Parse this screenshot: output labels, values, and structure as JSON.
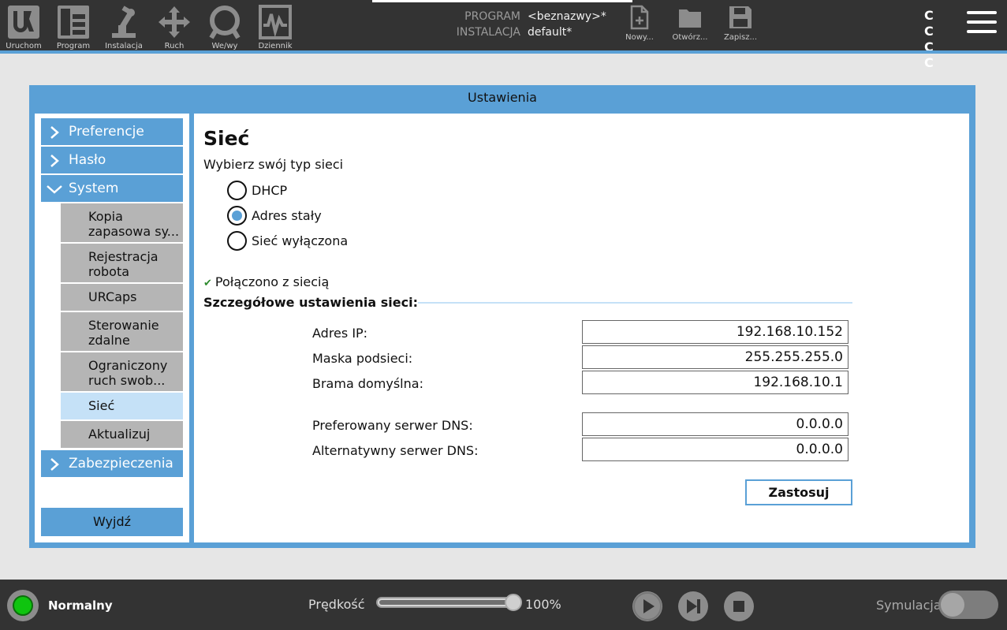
{
  "topbar": {
    "nav": [
      {
        "label": "Uruchom",
        "icon": "ur-logo-icon"
      },
      {
        "label": "Program",
        "icon": "program-tree-icon"
      },
      {
        "label": "Instalacja",
        "icon": "robot-arm-icon"
      },
      {
        "label": "Ruch",
        "icon": "move-arrows-icon"
      },
      {
        "label": "We/wy",
        "icon": "io-icon"
      },
      {
        "label": "Dziennik",
        "icon": "log-waveform-icon"
      }
    ],
    "program_key": "PROGRAM",
    "program_value": "<beznazwy>*",
    "installation_key": "INSTALACJA",
    "installation_value": "default*",
    "file_actions": [
      {
        "label": "Nowy...",
        "icon": "new-file-icon"
      },
      {
        "label": "Otwórz...",
        "icon": "folder-icon"
      },
      {
        "label": "Zapisz...",
        "icon": "save-disk-icon"
      }
    ],
    "cc_glyphs": "C C C C",
    "accent_color": "#5aa0d6"
  },
  "dialog": {
    "title": "Ustawienia",
    "sidebar": {
      "top_items": [
        {
          "label": "Preferencje",
          "expanded": false
        },
        {
          "label": "Hasło",
          "expanded": false
        },
        {
          "label": "System",
          "expanded": true
        },
        {
          "label": "Zabezpieczenia",
          "expanded": false
        }
      ],
      "system_items": [
        {
          "label": "Kopia\nzapasowa sy..."
        },
        {
          "label": "Rejestracja\nrobota"
        },
        {
          "label": "URCaps"
        },
        {
          "label": "Sterowanie\nzdalne"
        },
        {
          "label": "Ograniczony\nruch swob..."
        },
        {
          "label": "Sieć",
          "active": true
        },
        {
          "label": "Aktualizuj"
        }
      ],
      "exit_label": "Wyjdź"
    },
    "network": {
      "title": "Sieć",
      "choose_label": "Wybierz swój typ sieci",
      "options": [
        {
          "label": "DHCP",
          "selected": false
        },
        {
          "label": "Adres stały",
          "selected": true
        },
        {
          "label": "Sieć wyłączona",
          "selected": false
        }
      ],
      "status_text": "Połączono z siecią",
      "details_header": "Szczegółowe ustawienia sieci:",
      "fields": [
        {
          "label": "Adres IP:",
          "value": "192.168.10.152"
        },
        {
          "label": "Maska podsieci:",
          "value": "255.255.255.0"
        },
        {
          "label": "Brama domyślna:",
          "value": "192.168.10.1"
        },
        {
          "label": "Preferowany serwer DNS:",
          "value": "0.0.0.0"
        },
        {
          "label": "Alternatywny serwer DNS:",
          "value": "0.0.0.0"
        }
      ],
      "apply_label": "Zastosuj"
    }
  },
  "footer": {
    "mode_label": "Normalny",
    "status_color": "#0fc40f",
    "speed_label": "Prędkość",
    "speed_fraction": 1.0,
    "speed_value": "100%",
    "simulation_label": "Symulacja",
    "simulation_on": false
  }
}
